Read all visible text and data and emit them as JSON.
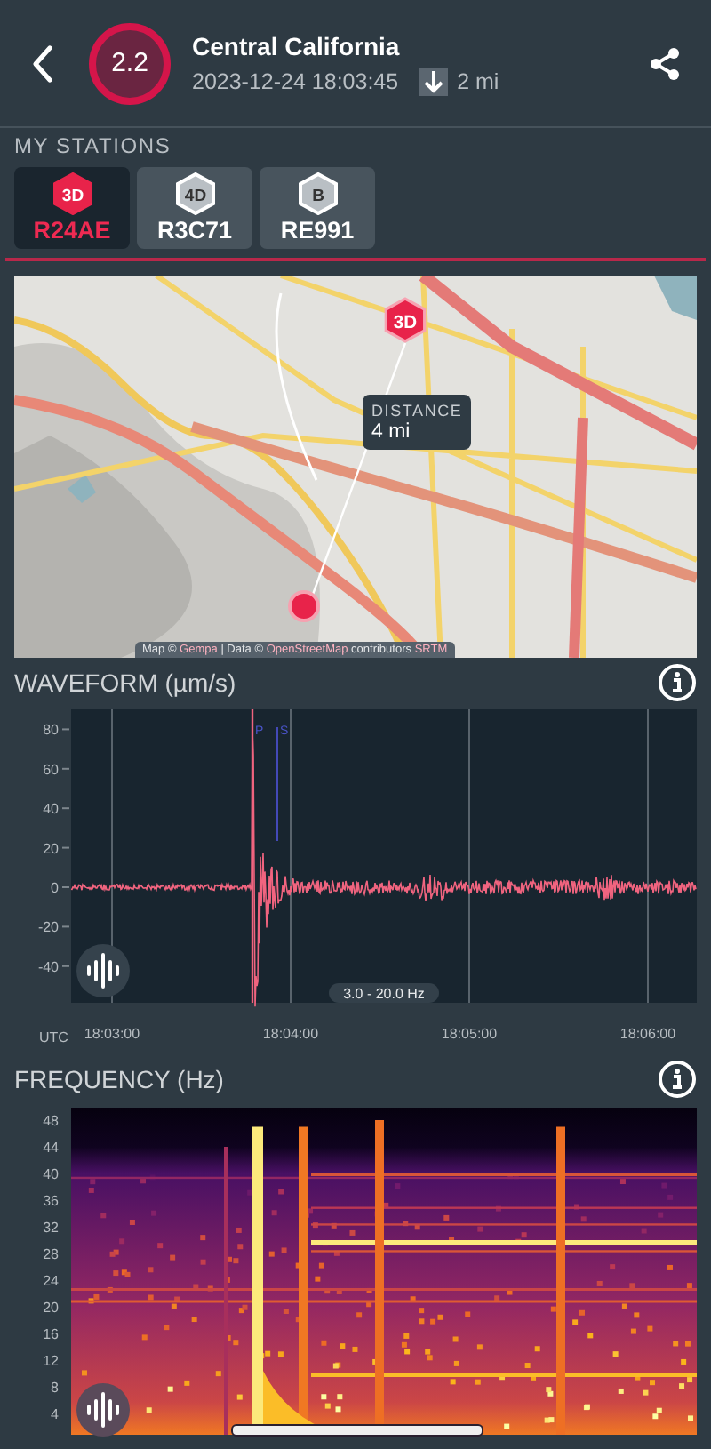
{
  "header": {
    "magnitude": "2.2",
    "title": "Central California",
    "datetime": "2023-12-24 18:03:45",
    "distance": "2 mi"
  },
  "stations": {
    "heading": "MY STATIONS",
    "items": [
      {
        "badge": "3D",
        "name": "R24AE",
        "selected": true
      },
      {
        "badge": "4D",
        "name": "R3C71",
        "selected": false
      },
      {
        "badge": "B",
        "name": "RE991",
        "selected": false
      }
    ]
  },
  "map": {
    "marker_badge": "3D",
    "tooltip": {
      "label": "DISTANCE",
      "value": "4 mi"
    },
    "attribution": [
      {
        "kind": "text",
        "text": "Map ©"
      },
      {
        "kind": "link",
        "text": "Gempa"
      },
      {
        "kind": "text",
        "text": "| Data ©"
      },
      {
        "kind": "link",
        "text": "OpenStreetMap"
      },
      {
        "kind": "text",
        "text": "contributors"
      },
      {
        "kind": "link",
        "text": "SRTM"
      }
    ]
  },
  "waveform": {
    "title": "WAVEFORM (µm/s)",
    "yticks": [
      "80",
      "60",
      "40",
      "20",
      "0",
      "-20",
      "-40"
    ],
    "xticks": [
      "18:03:00",
      "18:04:00",
      "18:05:00",
      "18:06:00"
    ],
    "x_unit": "UTC",
    "picks": [
      "P",
      "S"
    ],
    "band": "3.0 - 20.0 Hz"
  },
  "frequency": {
    "title": "FREQUENCY (Hz)",
    "yticks": [
      "48",
      "44",
      "40",
      "36",
      "32",
      "28",
      "24",
      "20",
      "16",
      "12",
      "8",
      "4"
    ]
  }
}
